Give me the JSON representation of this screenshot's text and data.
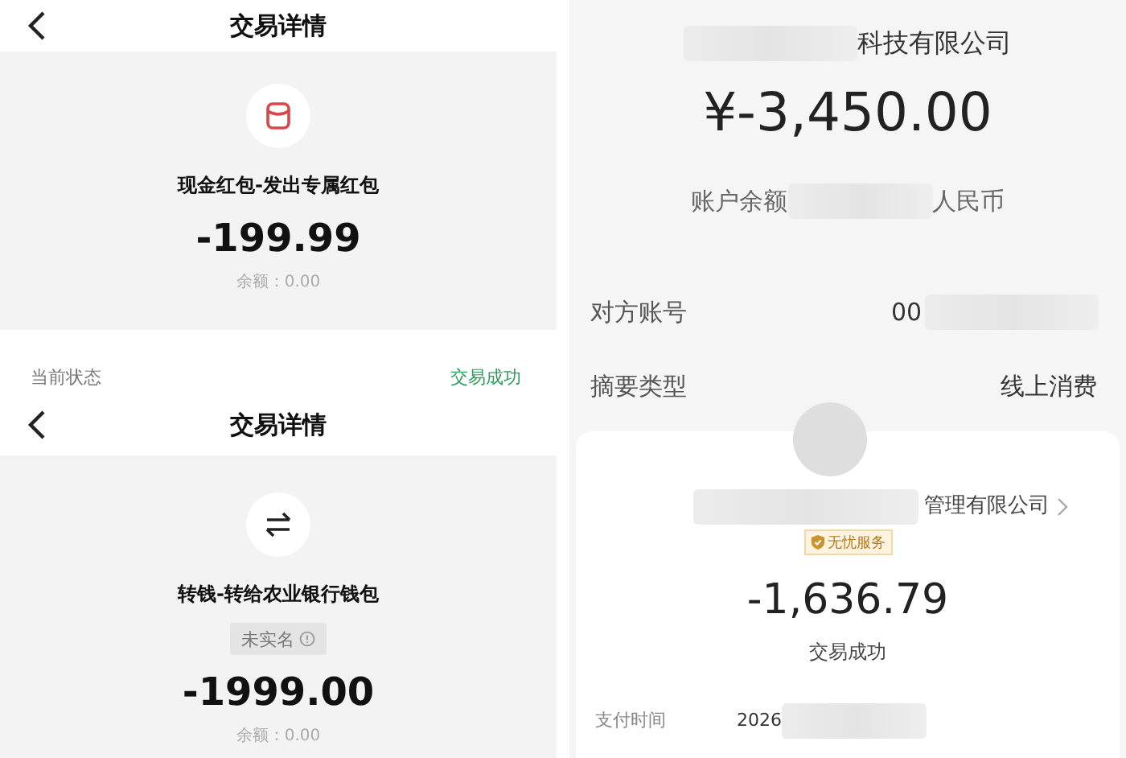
{
  "left_screens": [
    {
      "header": {
        "title": "交易详情"
      },
      "kind": "red_packet",
      "title": "现金红包-发出专属红包",
      "amount": "-199.99",
      "balance": "余额：0.00",
      "status_row": {
        "label": "当前状态",
        "value": "交易成功"
      }
    },
    {
      "header": {
        "title": "交易详情"
      },
      "kind": "transfer",
      "title": "转钱-转给农业银行钱包",
      "tag": "未实名",
      "amount": "-1999.00",
      "balance": "余额：0.00"
    }
  ],
  "bank_detail": {
    "company": "科技有限公司",
    "amount": "¥-3,450.00",
    "balance_label": "账户余额",
    "balance_currency": "人民币",
    "rows": [
      {
        "label": "对方账号",
        "value": "00",
        "kind": "masked"
      },
      {
        "label": "摘要类型",
        "value": "线上消费",
        "kind": "plain"
      }
    ]
  },
  "payment_card": {
    "merchant": "管理有限公司",
    "badge": "无忧服务",
    "amount": "-1,636.79",
    "status": "交易成功",
    "rows": [
      {
        "label": "支付时间",
        "value": "2026",
        "kind": "masked"
      }
    ]
  }
}
